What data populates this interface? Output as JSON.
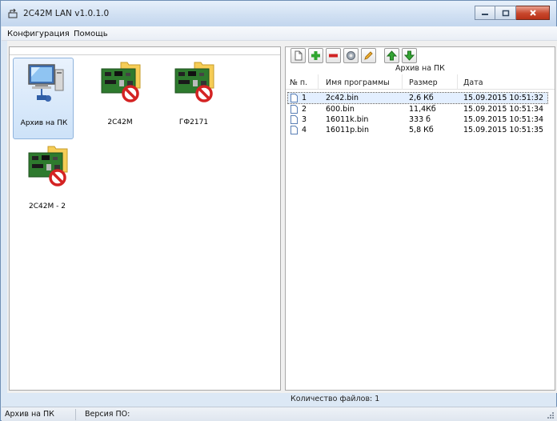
{
  "window": {
    "title": "2C42M LAN v1.0.1.0"
  },
  "menu": {
    "items": [
      "Конфигурация",
      "Помощь"
    ]
  },
  "devices": [
    {
      "label": "Архив на ПК",
      "icon": "pc-network-icon",
      "selected": true
    },
    {
      "label": "2С42М",
      "icon": "device-board-disconnected-icon",
      "selected": false
    },
    {
      "label": "ГФ2171",
      "icon": "device-board-disconnected-icon",
      "selected": false
    },
    {
      "label": "2С42М - 2",
      "icon": "device-board-disconnected-icon",
      "selected": false
    }
  ],
  "toolbar": {
    "buttons": [
      "new-file-icon",
      "add-icon",
      "remove-icon",
      "settings-icon",
      "edit-icon",
      "move-up-icon",
      "move-down-icon"
    ]
  },
  "archive": {
    "title": "Архив на ПК",
    "columns": [
      "№ п.",
      "Имя программы",
      "Размер",
      "Дата"
    ],
    "rows": [
      [
        "1",
        "2c42.bin",
        "2,6 Кб",
        "15.09.2015 10:51:32"
      ],
      [
        "2",
        "600.bin",
        "11,4Кб",
        "15.09.2015 10:51:34"
      ],
      [
        "3",
        "16011k.bin",
        "333 б",
        "15.09.2015 10:51:34"
      ],
      [
        "4",
        "16011p.bin",
        "5,8 Кб",
        "15.09.2015 10:51:35"
      ]
    ],
    "file_count_label": "Количество файлов: 1"
  },
  "status": {
    "location": "Архив на ПК",
    "firmware_label": "Версия ПО:"
  },
  "colors": {
    "selection": "#cde2f8",
    "close_button": "#c8472c",
    "add_green": "#2fa52f",
    "remove_red": "#d12424"
  }
}
